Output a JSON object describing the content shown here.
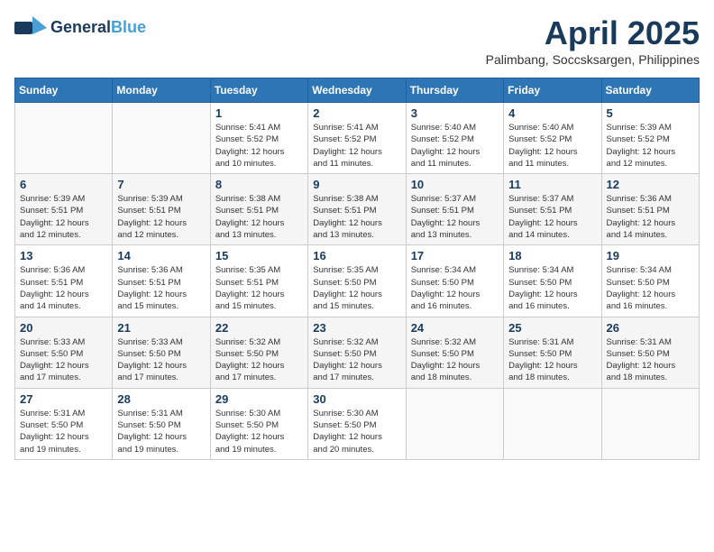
{
  "header": {
    "logo_line1": "General",
    "logo_line2": "Blue",
    "month_title": "April 2025",
    "subtitle": "Palimbang, Soccsksargen, Philippines"
  },
  "weekdays": [
    "Sunday",
    "Monday",
    "Tuesday",
    "Wednesday",
    "Thursday",
    "Friday",
    "Saturday"
  ],
  "weeks": [
    [
      {
        "day": "",
        "info": ""
      },
      {
        "day": "",
        "info": ""
      },
      {
        "day": "1",
        "info": "Sunrise: 5:41 AM\nSunset: 5:52 PM\nDaylight: 12 hours\nand 10 minutes."
      },
      {
        "day": "2",
        "info": "Sunrise: 5:41 AM\nSunset: 5:52 PM\nDaylight: 12 hours\nand 11 minutes."
      },
      {
        "day": "3",
        "info": "Sunrise: 5:40 AM\nSunset: 5:52 PM\nDaylight: 12 hours\nand 11 minutes."
      },
      {
        "day": "4",
        "info": "Sunrise: 5:40 AM\nSunset: 5:52 PM\nDaylight: 12 hours\nand 11 minutes."
      },
      {
        "day": "5",
        "info": "Sunrise: 5:39 AM\nSunset: 5:52 PM\nDaylight: 12 hours\nand 12 minutes."
      }
    ],
    [
      {
        "day": "6",
        "info": "Sunrise: 5:39 AM\nSunset: 5:51 PM\nDaylight: 12 hours\nand 12 minutes."
      },
      {
        "day": "7",
        "info": "Sunrise: 5:39 AM\nSunset: 5:51 PM\nDaylight: 12 hours\nand 12 minutes."
      },
      {
        "day": "8",
        "info": "Sunrise: 5:38 AM\nSunset: 5:51 PM\nDaylight: 12 hours\nand 13 minutes."
      },
      {
        "day": "9",
        "info": "Sunrise: 5:38 AM\nSunset: 5:51 PM\nDaylight: 12 hours\nand 13 minutes."
      },
      {
        "day": "10",
        "info": "Sunrise: 5:37 AM\nSunset: 5:51 PM\nDaylight: 12 hours\nand 13 minutes."
      },
      {
        "day": "11",
        "info": "Sunrise: 5:37 AM\nSunset: 5:51 PM\nDaylight: 12 hours\nand 14 minutes."
      },
      {
        "day": "12",
        "info": "Sunrise: 5:36 AM\nSunset: 5:51 PM\nDaylight: 12 hours\nand 14 minutes."
      }
    ],
    [
      {
        "day": "13",
        "info": "Sunrise: 5:36 AM\nSunset: 5:51 PM\nDaylight: 12 hours\nand 14 minutes."
      },
      {
        "day": "14",
        "info": "Sunrise: 5:36 AM\nSunset: 5:51 PM\nDaylight: 12 hours\nand 15 minutes."
      },
      {
        "day": "15",
        "info": "Sunrise: 5:35 AM\nSunset: 5:51 PM\nDaylight: 12 hours\nand 15 minutes."
      },
      {
        "day": "16",
        "info": "Sunrise: 5:35 AM\nSunset: 5:50 PM\nDaylight: 12 hours\nand 15 minutes."
      },
      {
        "day": "17",
        "info": "Sunrise: 5:34 AM\nSunset: 5:50 PM\nDaylight: 12 hours\nand 16 minutes."
      },
      {
        "day": "18",
        "info": "Sunrise: 5:34 AM\nSunset: 5:50 PM\nDaylight: 12 hours\nand 16 minutes."
      },
      {
        "day": "19",
        "info": "Sunrise: 5:34 AM\nSunset: 5:50 PM\nDaylight: 12 hours\nand 16 minutes."
      }
    ],
    [
      {
        "day": "20",
        "info": "Sunrise: 5:33 AM\nSunset: 5:50 PM\nDaylight: 12 hours\nand 17 minutes."
      },
      {
        "day": "21",
        "info": "Sunrise: 5:33 AM\nSunset: 5:50 PM\nDaylight: 12 hours\nand 17 minutes."
      },
      {
        "day": "22",
        "info": "Sunrise: 5:32 AM\nSunset: 5:50 PM\nDaylight: 12 hours\nand 17 minutes."
      },
      {
        "day": "23",
        "info": "Sunrise: 5:32 AM\nSunset: 5:50 PM\nDaylight: 12 hours\nand 17 minutes."
      },
      {
        "day": "24",
        "info": "Sunrise: 5:32 AM\nSunset: 5:50 PM\nDaylight: 12 hours\nand 18 minutes."
      },
      {
        "day": "25",
        "info": "Sunrise: 5:31 AM\nSunset: 5:50 PM\nDaylight: 12 hours\nand 18 minutes."
      },
      {
        "day": "26",
        "info": "Sunrise: 5:31 AM\nSunset: 5:50 PM\nDaylight: 12 hours\nand 18 minutes."
      }
    ],
    [
      {
        "day": "27",
        "info": "Sunrise: 5:31 AM\nSunset: 5:50 PM\nDaylight: 12 hours\nand 19 minutes."
      },
      {
        "day": "28",
        "info": "Sunrise: 5:31 AM\nSunset: 5:50 PM\nDaylight: 12 hours\nand 19 minutes."
      },
      {
        "day": "29",
        "info": "Sunrise: 5:30 AM\nSunset: 5:50 PM\nDaylight: 12 hours\nand 19 minutes."
      },
      {
        "day": "30",
        "info": "Sunrise: 5:30 AM\nSunset: 5:50 PM\nDaylight: 12 hours\nand 20 minutes."
      },
      {
        "day": "",
        "info": ""
      },
      {
        "day": "",
        "info": ""
      },
      {
        "day": "",
        "info": ""
      }
    ]
  ]
}
